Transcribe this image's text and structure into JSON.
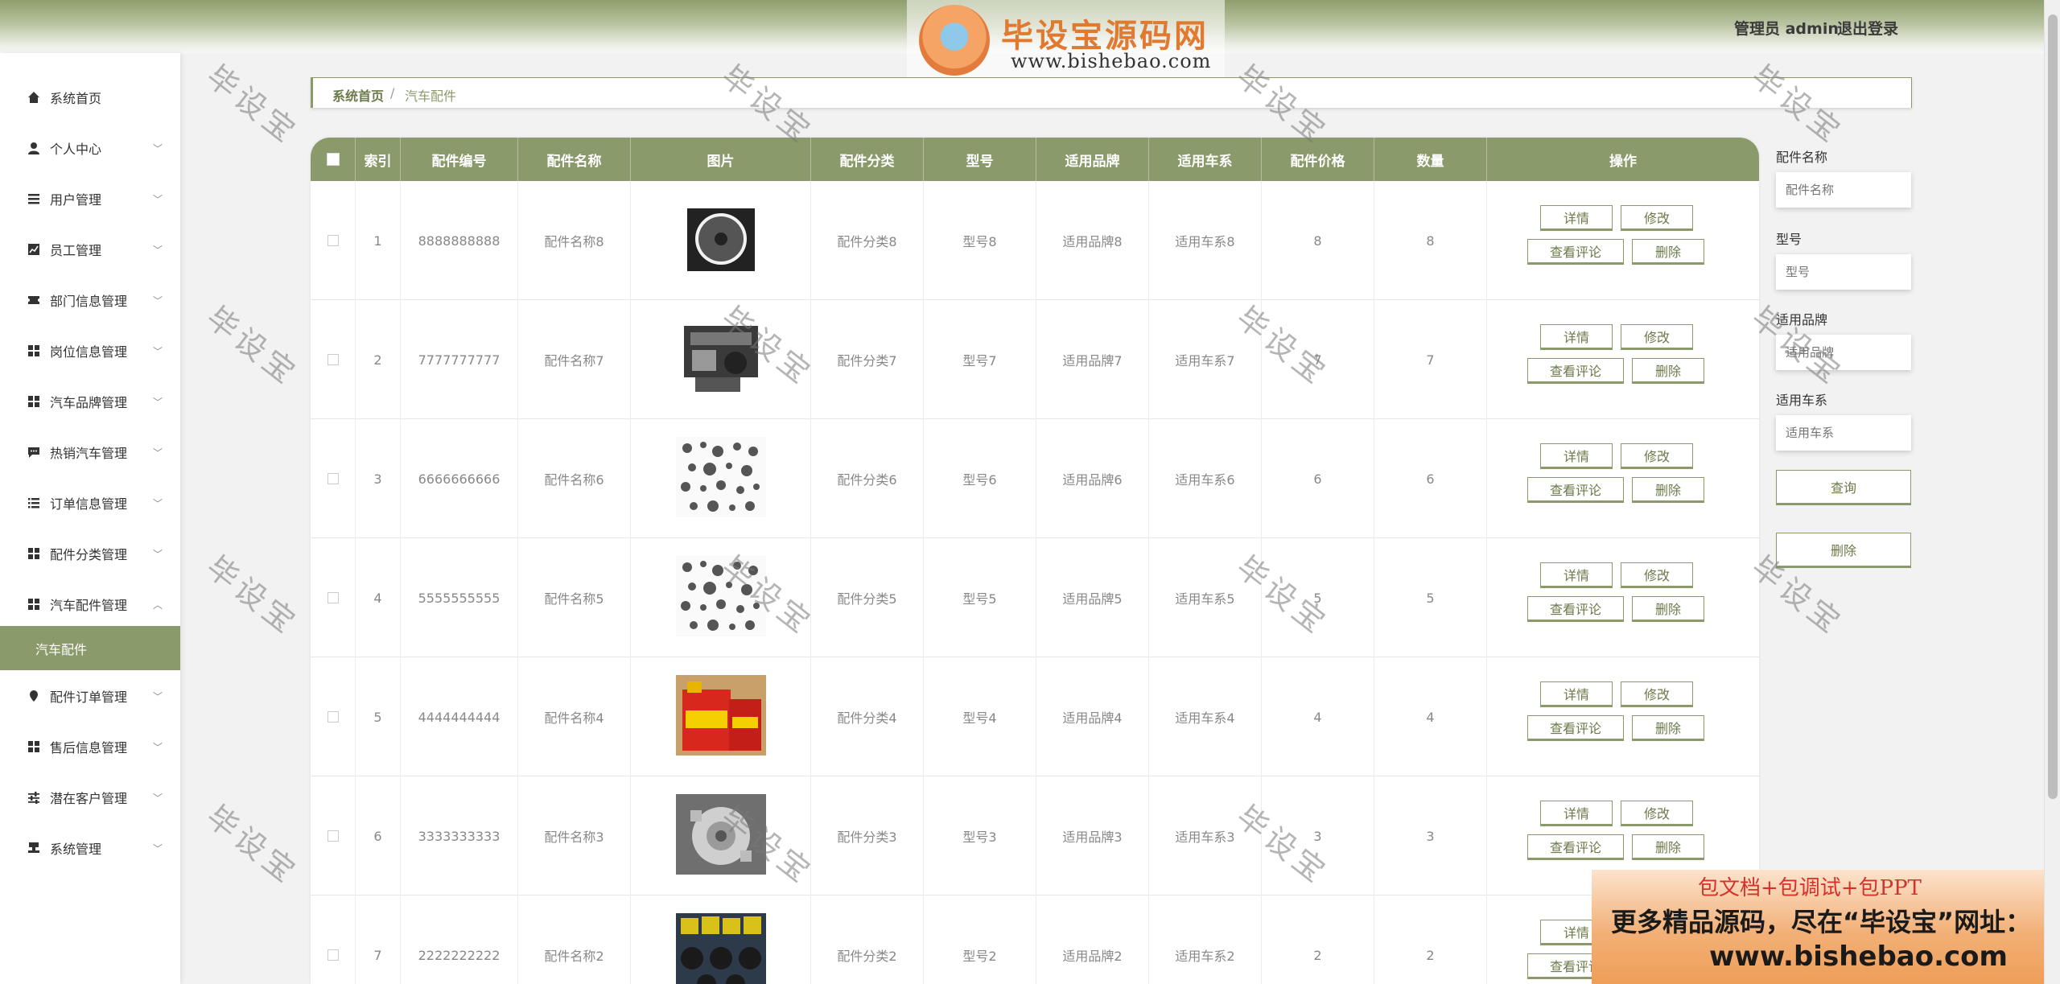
{
  "header": {
    "logo_text": "毕设宝源码网",
    "logo_url": "www.bishebao.com",
    "user_label": "管理员 admin",
    "logout_label": "退出登录"
  },
  "sidebar": {
    "items": [
      {
        "label": "系统首页",
        "icon": "home-icon",
        "expandable": false
      },
      {
        "label": "个人中心",
        "icon": "user-icon",
        "expandable": true
      },
      {
        "label": "用户管理",
        "icon": "list-icon",
        "expandable": true
      },
      {
        "label": "员工管理",
        "icon": "chart-icon",
        "expandable": true
      },
      {
        "label": "部门信息管理",
        "icon": "ticket-icon",
        "expandable": true
      },
      {
        "label": "岗位信息管理",
        "icon": "grid-icon",
        "expandable": true
      },
      {
        "label": "汽车品牌管理",
        "icon": "grid-icon",
        "expandable": true
      },
      {
        "label": "热销汽车管理",
        "icon": "chat-icon",
        "expandable": true
      },
      {
        "label": "订单信息管理",
        "icon": "list-icon",
        "expandable": true
      },
      {
        "label": "配件分类管理",
        "icon": "grid-icon",
        "expandable": true
      },
      {
        "label": "汽车配件管理",
        "icon": "grid-icon",
        "expandable": true,
        "expanded": true
      },
      {
        "label": "配件订单管理",
        "icon": "pin-icon",
        "expandable": true
      },
      {
        "label": "售后信息管理",
        "icon": "grid-icon",
        "expandable": true
      },
      {
        "label": "潜在客户管理",
        "icon": "sliders-icon",
        "expandable": true
      },
      {
        "label": "系统管理",
        "icon": "stamp-icon",
        "expandable": true
      }
    ],
    "active_sub": "汽车配件"
  },
  "breadcrumb": {
    "home": "系统首页",
    "separator": "/",
    "current": "汽车配件"
  },
  "table": {
    "columns": [
      "索引",
      "配件编号",
      "配件名称",
      "图片",
      "配件分类",
      "型号",
      "适用品牌",
      "适用车系",
      "配件价格",
      "数量",
      "操作"
    ],
    "rows": [
      {
        "index": "1",
        "code": "8888888888",
        "name": "配件名称8",
        "image": "fan-shroud",
        "category": "配件分类8",
        "model": "型号8",
        "brand": "适用品牌8",
        "series": "适用车系8",
        "price": "8",
        "qty": "8"
      },
      {
        "index": "2",
        "code": "7777777777",
        "name": "配件名称7",
        "image": "engine",
        "category": "配件分类7",
        "model": "型号7",
        "brand": "适用品牌7",
        "series": "适用车系7",
        "price": "7",
        "qty": "7"
      },
      {
        "index": "3",
        "code": "6666666666",
        "name": "配件名称6",
        "image": "parts-collage",
        "category": "配件分类6",
        "model": "型号6",
        "brand": "适用品牌6",
        "series": "适用车系6",
        "price": "6",
        "qty": "6"
      },
      {
        "index": "4",
        "code": "5555555555",
        "name": "配件名称5",
        "image": "parts-collage",
        "category": "配件分类5",
        "model": "型号5",
        "brand": "适用品牌5",
        "series": "适用车系5",
        "price": "5",
        "qty": "5"
      },
      {
        "index": "5",
        "code": "4444444444",
        "name": "配件名称4",
        "image": "oil-bottles",
        "category": "配件分类4",
        "model": "型号4",
        "brand": "适用品牌4",
        "series": "适用车系4",
        "price": "4",
        "qty": "4"
      },
      {
        "index": "6",
        "code": "3333333333",
        "name": "配件名称3",
        "image": "water-pump",
        "category": "配件分类3",
        "model": "型号3",
        "brand": "适用品牌3",
        "series": "适用车系3",
        "price": "3",
        "qty": "3"
      },
      {
        "index": "7",
        "code": "2222222222",
        "name": "配件名称2",
        "image": "filters",
        "category": "配件分类2",
        "model": "型号2",
        "brand": "适用品牌2",
        "series": "适用车系2",
        "price": "2",
        "qty": "2"
      }
    ],
    "actions": {
      "detail": "详情",
      "edit": "修改",
      "reviews": "查看评论",
      "delete": "删除"
    }
  },
  "search": {
    "name_label": "配件名称",
    "name_placeholder": "配件名称",
    "model_label": "型号",
    "model_placeholder": "型号",
    "brand_label": "适用品牌",
    "brand_placeholder": "适用品牌",
    "series_label": "适用车系",
    "series_placeholder": "适用车系",
    "query_label": "查询",
    "delete_label": "删除"
  },
  "watermark": "毕设宝",
  "promo": {
    "line1": "包文档+包调试+包PPT",
    "line2": "更多精品源码，尽在“毕设宝”网址：",
    "line3": "www.bishebao.com"
  },
  "colors": {
    "accent": "#8a9a6a",
    "accent_dark": "#6b7a4a"
  }
}
